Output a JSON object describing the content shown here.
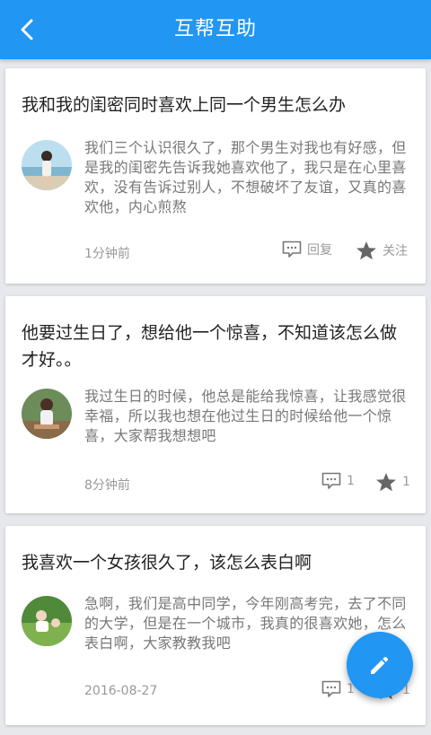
{
  "header": {
    "title": "互帮互助",
    "back_icon": "chevron-left-icon",
    "bg_color": "#2196f3"
  },
  "posts": [
    {
      "title": "我和我的闺密同时喜欢上同一个男生怎么办",
      "summary": "我们三个认识很久了，那个男生对我也有好感，但是我的闺密先告诉我她喜欢他了，我只是在心里喜欢，没有告诉过别人，不想破坏了友谊，又真的喜欢他，内心煎熬",
      "time": "1分钟前",
      "reply_label": "回复",
      "follow_label": "关注"
    },
    {
      "title": "他要过生日了，想给他一个惊喜，不知道该怎么做才好。。",
      "summary": "我过生日的时候，他总是能给我惊喜，让我感觉很幸福，所以我也想在他过生日的时候给他一个惊喜，大家帮我想想吧",
      "time": "8分钟前",
      "reply_label": "1",
      "follow_label": "1"
    },
    {
      "title": "我喜欢一个女孩很久了，该怎么表白啊",
      "summary": "急啊，我们是高中同学，今年刚高考完，去了不同的大学，但是在一个城市，我真的很喜欢她，怎么表白啊，大家教教我吧",
      "time": "2016-08-27",
      "reply_label": "1",
      "follow_label": "1"
    }
  ],
  "fab": {
    "icon": "pencil-icon"
  }
}
